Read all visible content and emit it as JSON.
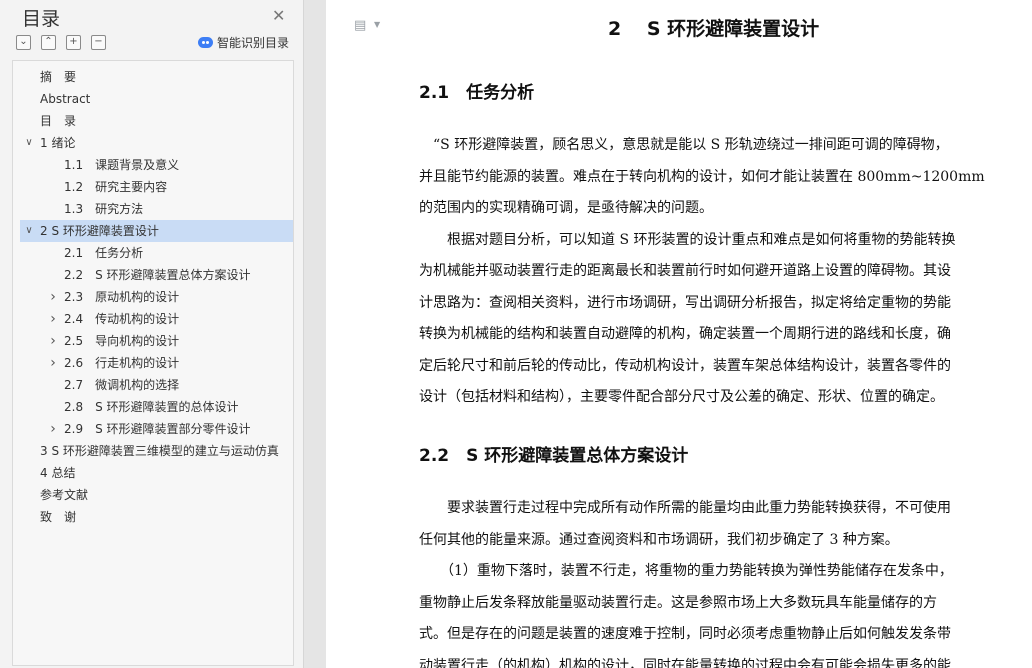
{
  "sidebar": {
    "title": "目录",
    "smart_label": "智能识别目录",
    "tools": [
      "⌄",
      "⌃",
      "+",
      "−"
    ],
    "toc": [
      {
        "label": "摘　要",
        "level": 0,
        "expand": ""
      },
      {
        "label": "Abstract",
        "level": 0,
        "expand": ""
      },
      {
        "label": "目　录",
        "level": 0,
        "expand": ""
      },
      {
        "label": "1  绪论",
        "level": 0,
        "expand": "down"
      },
      {
        "label": "1.1　课题背景及意义",
        "level": 1,
        "expand": ""
      },
      {
        "label": "1.2　研究主要内容",
        "level": 1,
        "expand": ""
      },
      {
        "label": "1.3　研究方法",
        "level": 1,
        "expand": ""
      },
      {
        "label": "2  S 环形避障装置设计",
        "level": 0,
        "expand": "down",
        "active": true
      },
      {
        "label": "2.1　任务分析",
        "level": 1,
        "expand": ""
      },
      {
        "label": "2.2　S 环形避障装置总体方案设计",
        "level": 1,
        "expand": ""
      },
      {
        "label": "2.3　原动机构的设计",
        "level": 1,
        "expand": "right"
      },
      {
        "label": "2.4　传动机构的设计",
        "level": 1,
        "expand": "right"
      },
      {
        "label": "2.5　导向机构的设计",
        "level": 1,
        "expand": "right"
      },
      {
        "label": "2.6　行走机构的设计",
        "level": 1,
        "expand": "right"
      },
      {
        "label": "2.7　微调机构的选择",
        "level": 1,
        "expand": ""
      },
      {
        "label": "2.8　S 环形避障装置的总体设计",
        "level": 1,
        "expand": ""
      },
      {
        "label": "2.9　S 环形避障装置部分零件设计",
        "level": 1,
        "expand": "right"
      },
      {
        "label": "3 S 环形避障装置三维模型的建立与运动仿真",
        "level": -1,
        "expand": ""
      },
      {
        "label": "4 总结",
        "level": 0,
        "expand": ""
      },
      {
        "label": "参考文献",
        "level": 0,
        "expand": ""
      },
      {
        "label": "致　谢",
        "level": 0,
        "expand": ""
      }
    ]
  },
  "document": {
    "chapter_title": "2　 S 环形避障装置设计",
    "sections": [
      {
        "title": "2.1　任务分析",
        "lines": [
          "　“S 环形避障装置，顾名思义，意思就是能以 S 形轨迹绕过一排间距可调的障碍物，",
          "并且能节约能源的装置。难点在于转向机构的设计，如何才能让装置在 800mm~1200mm",
          "的范围内的实现精确可调，是亟待解决的问题。",
          "　　根据对题目分析，可以知道 S 环形装置的设计重点和难点是如何将重物的势能转换",
          "为机械能并驱动装置行走的距离最长和装置前行时如何避开道路上设置的障碍物。其设",
          "计思路为：查阅相关资料，进行市场调研，写出调研分析报告，拟定将给定重物的势能",
          "转换为机械能的结构和装置自动避障的机构，确定装置一个周期行进的路线和长度，确",
          "定后轮尺寸和前后轮的传动比，传动机构设计，装置车架总体结构设计，装置各零件的",
          "设计（包括材料和结构），主要零件配合部分尺寸及公差的确定、形状、位置的确定。"
        ]
      },
      {
        "title": "2.2　S 环形避障装置总体方案设计",
        "lines": [
          "　　要求装置行走过程中完成所有动作所需的能量均由此重力势能转换获得，不可使用",
          "任何其他的能量来源。通过查阅资料和市场调研，我们初步确定了 3 种方案。",
          "　　（1）重物下落时，装置不行走，将重物的重力势能转换为弹性势能储存在发条中，",
          "重物静止后发条释放能量驱动装置行走。这是参照市场上大多数玩具车能量储存的方",
          "式。但是存在的问题是装置的速度难于控制，同时必须考虑重物静止后如何触发发条带",
          "动装置行走（的机构）机构的设计，同时在能量转换的过程中会有可能会损失更多的能"
        ]
      }
    ]
  }
}
